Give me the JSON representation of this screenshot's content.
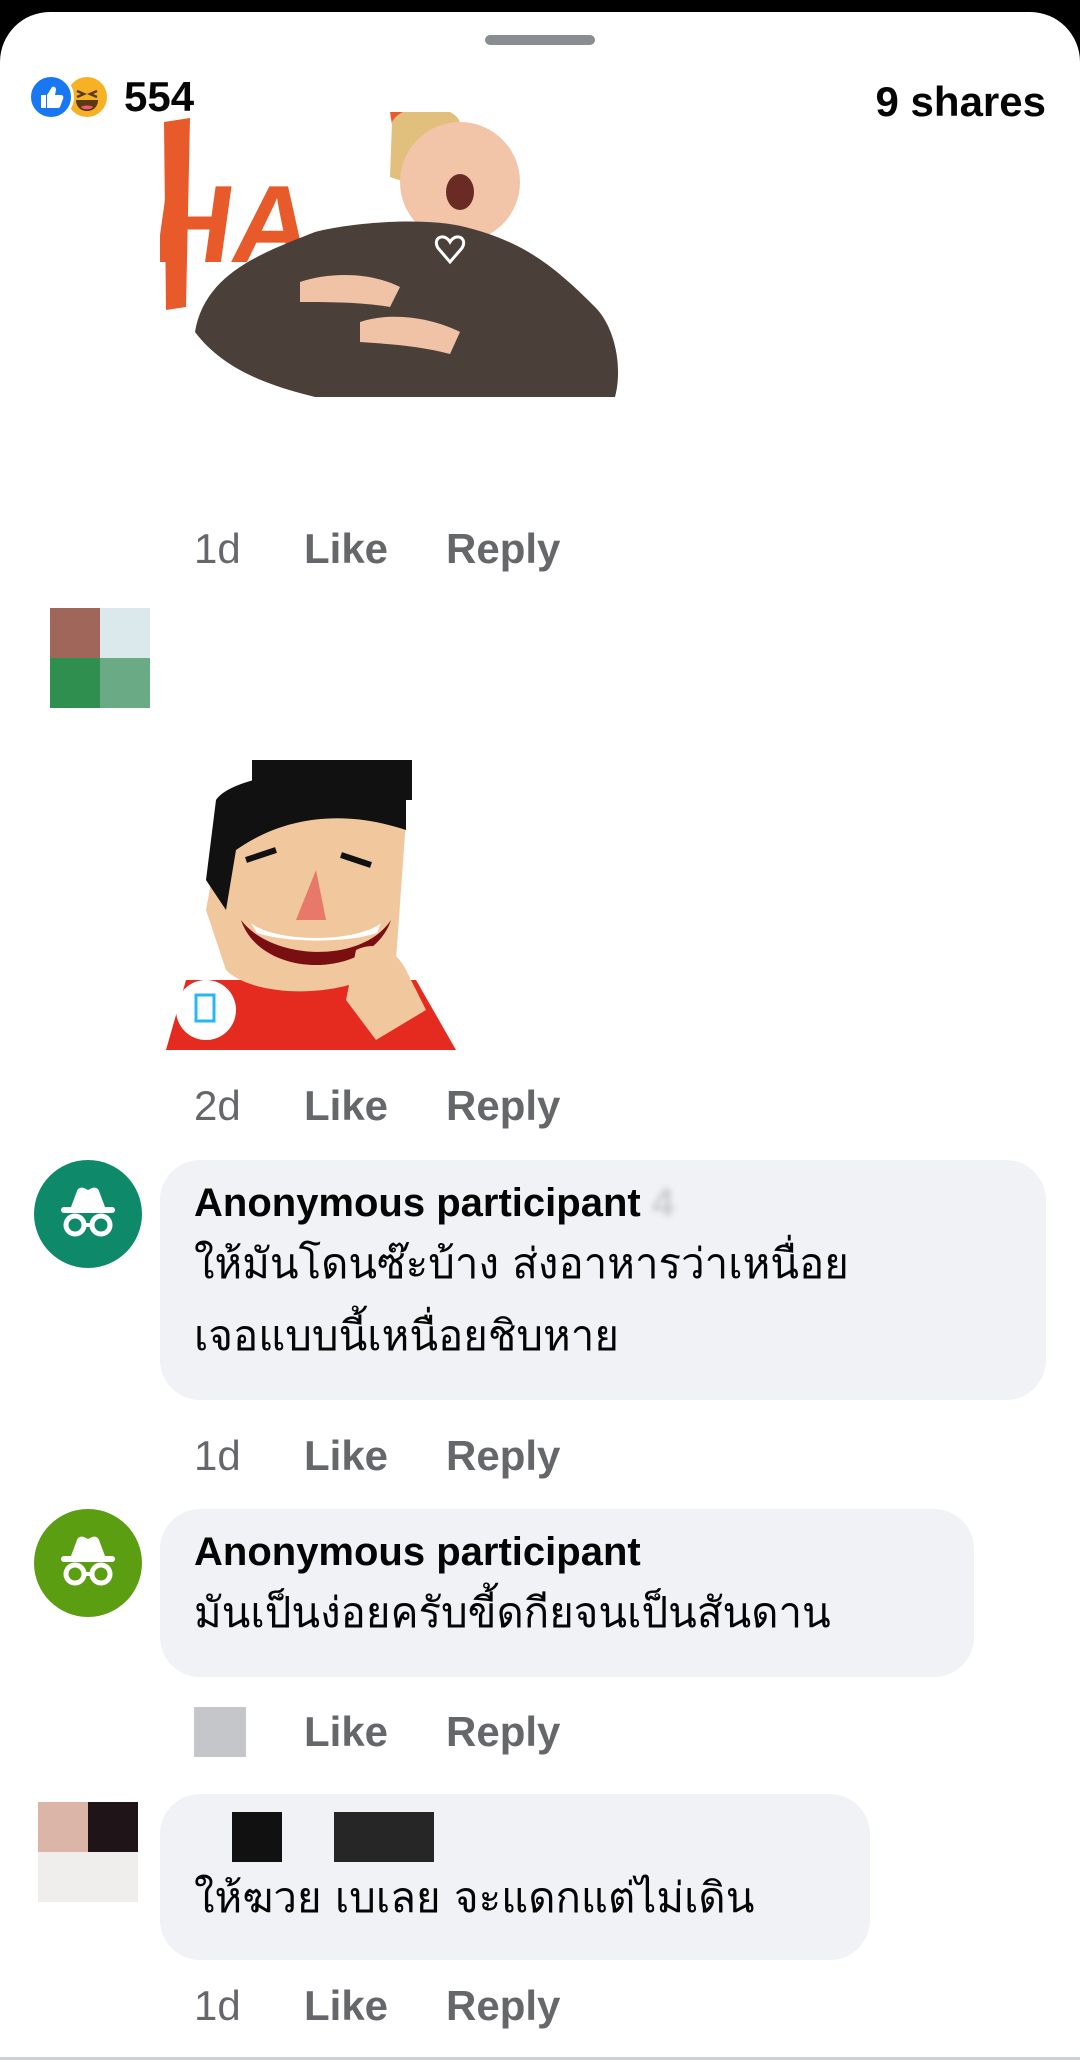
{
  "header": {
    "reaction_count": "554",
    "shares": "9 shares",
    "reaction_icons": [
      "like-icon",
      "haha-icon"
    ]
  },
  "comments": [
    {
      "type": "sticker",
      "sticker": "laughing-woman-sticker",
      "sticker_text": "HA",
      "time": "1d",
      "like": "Like",
      "reply": "Reply"
    },
    {
      "type": "sticker",
      "sticker": "laughing-man-sticker",
      "time": "2d",
      "like": "Like",
      "reply": "Reply"
    },
    {
      "type": "text",
      "author": "Anonymous participant",
      "author_suffix": "4",
      "text_lines": [
        "ให้มันโดนซ๊ะบ้าง ส่งอาหารว่าเหนื่อย",
        "เจอแบบนี้เหนื่อยชิบหาย"
      ],
      "time": "1d",
      "like": "Like",
      "reply": "Reply",
      "avatar_color": "#0e8a6b"
    },
    {
      "type": "text",
      "author": "Anonymous participant",
      "text_lines": [
        "มันเป็นง่อยครับขี้ดกียจนเป็นสันดาน"
      ],
      "like": "Like",
      "reply": "Reply",
      "avatar_color": "#5b9e12"
    },
    {
      "type": "text",
      "text_lines": [
        "ให้ฆวย เบเลย จะแดกแต่ไม่เดิน"
      ],
      "time": "1d",
      "like": "Like",
      "reply": "Reply"
    }
  ],
  "colors": {
    "facebook_blue": "#1877f2",
    "bubble_bg": "#f0f2f5",
    "meta_text": "#65676b"
  }
}
